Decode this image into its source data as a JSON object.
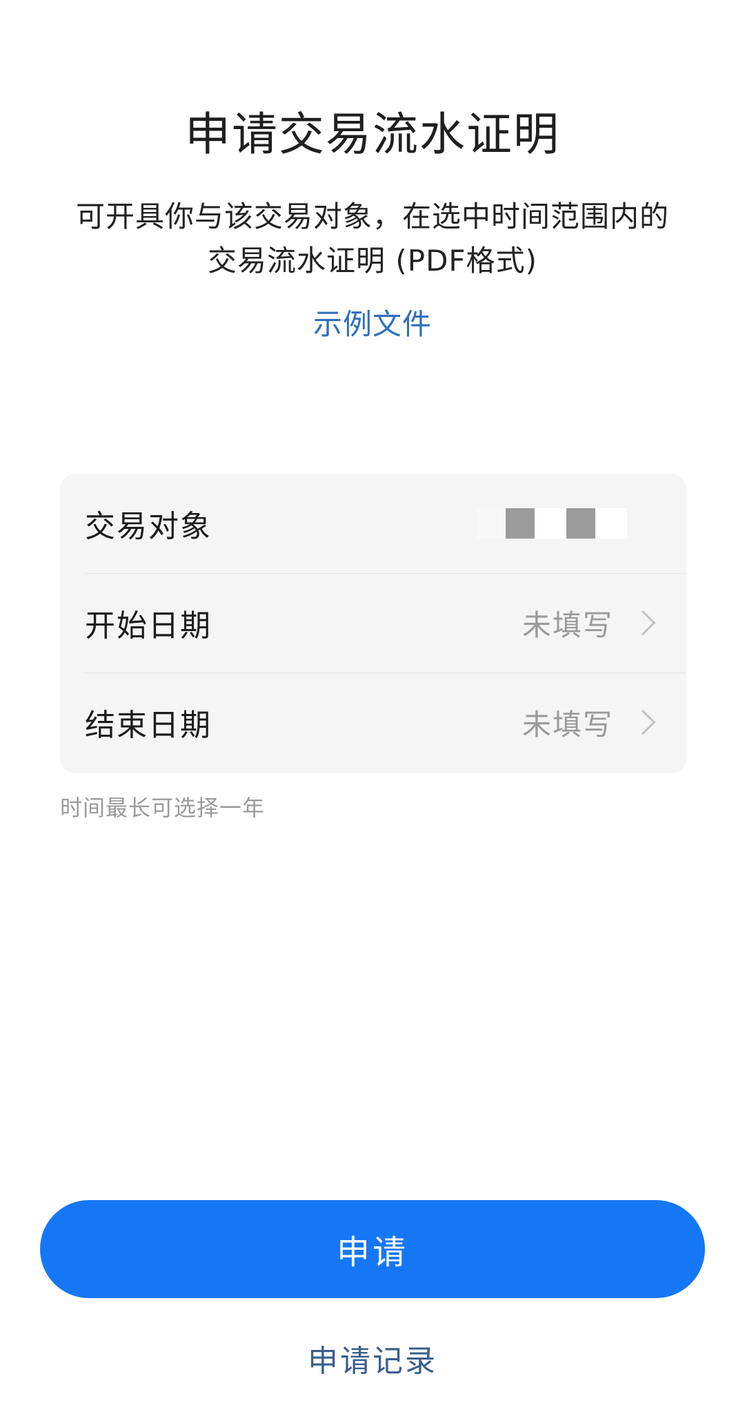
{
  "header": {
    "title": "申请交易流水证明",
    "description_line1": "可开具你与该交易对象，在选中时间范围内的",
    "description_line2": "交易流水证明 (PDF格式)",
    "sample_link": "示例文件"
  },
  "form": {
    "rows": [
      {
        "label": "交易对象",
        "value": ""
      },
      {
        "label": "开始日期",
        "value": "未填写"
      },
      {
        "label": "结束日期",
        "value": "未填写"
      }
    ],
    "hint": "时间最长可选择一年"
  },
  "actions": {
    "apply_label": "申请",
    "records_label": "申请记录"
  },
  "colors": {
    "primary": "#1677f6",
    "link": "#2f6fbd",
    "card_bg": "#f5f5f5",
    "placeholder": "#9a9a9a"
  },
  "icons": {
    "row_arrow": "chevron-right-icon"
  }
}
